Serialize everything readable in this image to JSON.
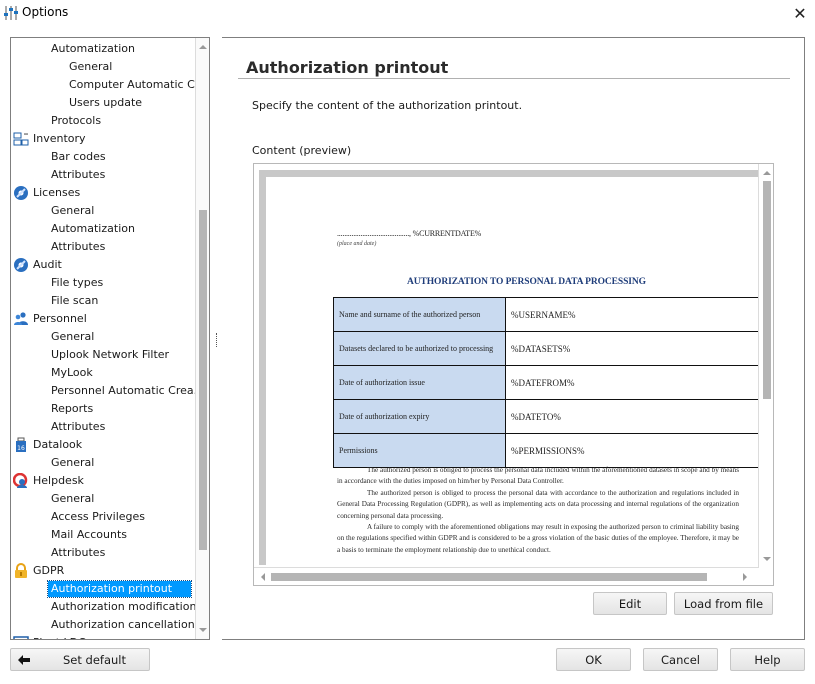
{
  "window": {
    "title": "Options",
    "icons": {
      "app": "sliders-icon",
      "close": "close-icon"
    },
    "close_glyph": "✕"
  },
  "tree": {
    "items": [
      {
        "label": "Automatization",
        "level": 1
      },
      {
        "label": "General",
        "level": 2
      },
      {
        "label": "Computer Automatic C...",
        "level": 2
      },
      {
        "label": "Users update",
        "level": 2
      },
      {
        "label": "Protocols",
        "level": 1
      },
      {
        "label": "Inventory",
        "level": 0,
        "icon": "inventory-network-icon"
      },
      {
        "label": "Bar codes",
        "level": 1
      },
      {
        "label": "Attributes",
        "level": 1
      },
      {
        "label": "Licenses",
        "level": 0,
        "icon": "disc-icon"
      },
      {
        "label": "General",
        "level": 1
      },
      {
        "label": "Automatization",
        "level": 1
      },
      {
        "label": "Attributes",
        "level": 1
      },
      {
        "label": "Audit",
        "level": 0,
        "icon": "disc-icon"
      },
      {
        "label": "File types",
        "level": 1
      },
      {
        "label": "File scan",
        "level": 1
      },
      {
        "label": "Personnel",
        "level": 0,
        "icon": "users-icon"
      },
      {
        "label": "General",
        "level": 1
      },
      {
        "label": "Uplook Network Filter",
        "level": 1
      },
      {
        "label": "MyLook",
        "level": 1
      },
      {
        "label": "Personnel Automatic Crea...",
        "level": 1
      },
      {
        "label": "Reports",
        "level": 1
      },
      {
        "label": "Attributes",
        "level": 1
      },
      {
        "label": "Datalook",
        "level": 0,
        "icon": "usb-drive-icon"
      },
      {
        "label": "General",
        "level": 1
      },
      {
        "label": "Helpdesk",
        "level": 0,
        "icon": "helpdesk-lifebuoy-icon"
      },
      {
        "label": "General",
        "level": 1
      },
      {
        "label": "Access Privileges",
        "level": 1
      },
      {
        "label": "Mail Accounts",
        "level": 1
      },
      {
        "label": "Attributes",
        "level": 1
      },
      {
        "label": "GDPR",
        "level": 0,
        "icon": "padlock-icon"
      },
      {
        "label": "Authorization printout",
        "level": 1,
        "selected": true
      },
      {
        "label": "Authorization modification...",
        "level": 1
      },
      {
        "label": "Authorization cancellation ...",
        "level": 1
      },
      {
        "label": "Pivot LDC",
        "level": 0,
        "icon": "window-icon"
      }
    ],
    "selected_color": "#0099ff"
  },
  "main": {
    "title": "Authorization printout",
    "description": "Specify the content of the authorization printout.",
    "content_label": "Content (preview)",
    "preview": {
      "date_line": "........................................, %CURRENTDATE%",
      "place_caption": "(place and date)",
      "heading": "AUTHORIZATION TO PERSONAL DATA PROCESSING",
      "heading_color": "#1f3d7a",
      "table": [
        {
          "key": "Name and surname of the authorized person",
          "value": "%USERNAME%"
        },
        {
          "key": "Datasets declared to be authorized to processing",
          "value": "%DATASETS%"
        },
        {
          "key": "Date of authorization issue",
          "value": "%DATEFROM%"
        },
        {
          "key": "Date of authorization expiry",
          "value": "%DATETO%"
        },
        {
          "key": "Permissions",
          "value": "%PERMISSIONS%"
        }
      ],
      "key_cell_color": "#c9daf0",
      "paragraphs": [
        "The authorized person is obliged to process the personal data included within the aforementioned datasets in scope and by means in accordance with the duties imposed on him/her by Personal Data Controller.",
        "The authorized person is obliged to process the personal data with accordance to the authorization and regulations included in General Data Processing Regulation (GDPR), as well as implementing acts on data processing and internal regulations of the organization concerning personal data processing.",
        "A failure to comply with the aforementioned obligations may result in exposing the authorized person to criminal liability basing on the regulations specified within GDPR and is considered to be a gross violation of the basic duties of the employee. Therefore, it may be a basis to terminate the employment relationship due to unethical conduct."
      ]
    },
    "buttons": {
      "edit": "Edit",
      "load": "Load from file"
    }
  },
  "footer": {
    "set_default": "Set default",
    "ok": "OK",
    "cancel": "Cancel",
    "help": "Help"
  }
}
